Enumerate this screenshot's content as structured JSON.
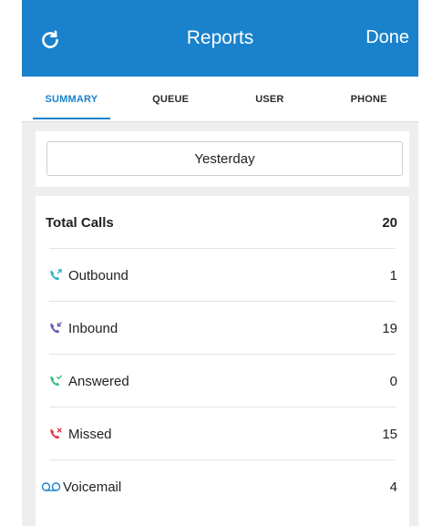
{
  "header": {
    "title": "Reports",
    "done_label": "Done"
  },
  "tabs": [
    {
      "label": "SUMMARY",
      "active": true
    },
    {
      "label": "QUEUE",
      "active": false
    },
    {
      "label": "USER",
      "active": false
    },
    {
      "label": "PHONE",
      "active": false
    }
  ],
  "date_selector": {
    "label": "Yesterday"
  },
  "summary": {
    "total": {
      "label": "Total Calls",
      "value": "20"
    },
    "rows": [
      {
        "label": "Outbound",
        "value": "1",
        "icon": "outbound-call-icon",
        "color": "#2fb3c9"
      },
      {
        "label": "Inbound",
        "value": "19",
        "icon": "inbound-call-icon",
        "color": "#6b55b8"
      },
      {
        "label": "Answered",
        "value": "0",
        "icon": "answered-call-icon",
        "color": "#3cbf86"
      },
      {
        "label": "Missed",
        "value": "15",
        "icon": "missed-call-icon",
        "color": "#e4394b"
      },
      {
        "label": "Voicemail",
        "value": "4",
        "icon": "voicemail-icon",
        "color": "#1a82cc"
      }
    ]
  },
  "colors": {
    "accent": "#1a82cc",
    "background": "#eeeeee"
  }
}
